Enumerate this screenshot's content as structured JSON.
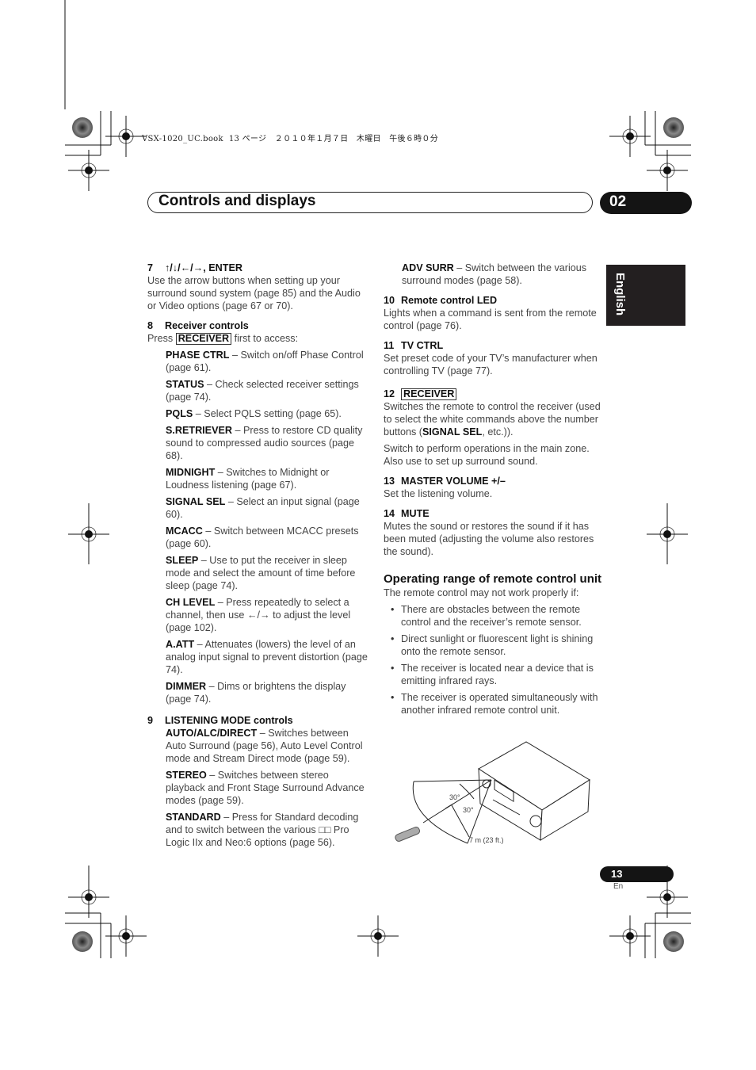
{
  "book_header": "VSX-1020_UC.book  13 ページ   ２０１０年１月７日   木曜日   午後６時０分",
  "chapter": {
    "title": "Controls and displays",
    "number": "02"
  },
  "language_tab": "English",
  "left_column": {
    "item7": {
      "number": "7",
      "title": "↑/↓/←/→, ENTER",
      "text": "Use the arrow buttons when setting up your surround sound system (page 85) and the Audio or Video options (page 67 or 70)."
    },
    "item8": {
      "number": "8",
      "title": "Receiver controls",
      "intro_before": "Press ",
      "intro_key": "RECEIVER",
      "intro_after": " first to access:",
      "entries": [
        {
          "name": "PHASE CTRL",
          "desc": " – Switch on/off Phase Control (page 61)."
        },
        {
          "name": "STATUS",
          "desc": " – Check selected receiver settings (page 74)."
        },
        {
          "name": "PQLS",
          "desc": " – Select PQLS setting (page 65)."
        },
        {
          "name": "S.RETRIEVER",
          "desc": " – Press to restore CD quality sound to compressed audio sources (page 68)."
        },
        {
          "name": "MIDNIGHT",
          "desc": " – Switches to Midnight or Loudness listening (page 67)."
        },
        {
          "name": "SIGNAL SEL",
          "desc": " – Select an input signal (page 60)."
        },
        {
          "name": "MCACC",
          "desc": " – Switch between MCACC presets (page 60)."
        },
        {
          "name": "SLEEP",
          "desc": " – Use to put the receiver in sleep mode and select the amount of time before sleep (page 74)."
        },
        {
          "name": "CH LEVEL",
          "desc": " – Press repeatedly to select a channel, then use ←/→ to adjust the level (page 102)."
        },
        {
          "name": "A.ATT",
          "desc": " – Attenuates (lowers) the level of an analog input signal to prevent distortion (page 74)."
        },
        {
          "name": "DIMMER",
          "desc": " – Dims or brightens the display (page 74)."
        }
      ]
    },
    "item9": {
      "number": "9",
      "title": "LISTENING MODE controls",
      "entries": [
        {
          "name": "AUTO/ALC/DIRECT",
          "desc": " – Switches between Auto Surround (page 56), Auto Level Control mode and Stream Direct mode (page 59)."
        },
        {
          "name": "STEREO",
          "desc": " – Switches between stereo playback and Front Stage Surround Advance modes (page 59)."
        },
        {
          "name": "STANDARD",
          "desc": " – Press for Standard decoding and to switch between the various □□ Pro Logic IIx and Neo:6 options (page 56)."
        }
      ]
    }
  },
  "right_column": {
    "adv_surr": {
      "name": "ADV SURR",
      "desc": " – Switch between the various surround modes (page 58)."
    },
    "item10": {
      "number": "10",
      "title": "Remote control LED",
      "text": "Lights when a command is sent from the remote control (page 76)."
    },
    "item11": {
      "number": "11",
      "title": "TV CTRL",
      "text": "Set preset code of your TV’s manufacturer when controlling TV (page 77)."
    },
    "item12": {
      "number": "12",
      "key": "RECEIVER",
      "text1_before": "Switches the remote to control the receiver (used to select the white commands above the number buttons (",
      "text1_bold": "SIGNAL SEL",
      "text1_after": ", etc.)).",
      "text2": "Switch to perform operations in the main zone. Also use to set up surround sound."
    },
    "item13": {
      "number": "13",
      "title": "MASTER VOLUME +/–",
      "text": "Set the listening volume."
    },
    "item14": {
      "number": "14",
      "title": "MUTE",
      "text": "Mutes the sound or restores the sound if it has been muted (adjusting the volume also restores the sound)."
    },
    "operating_range": {
      "title": "Operating range of remote control unit",
      "intro": "The remote control may not work properly if:",
      "bullets": [
        "There are obstacles between the remote control and the receiver’s remote sensor.",
        "Direct sunlight or fluorescent light is shining onto the remote sensor.",
        "The receiver is located near a device that is emitting infrared rays.",
        "The receiver is operated simultaneously with another infrared remote control unit."
      ]
    },
    "diagram": {
      "angle_upper": "30°",
      "angle_lower": "30°",
      "distance": "7 m (23 ft.)"
    }
  },
  "footer": {
    "page_number": "13",
    "page_lang": "En"
  }
}
